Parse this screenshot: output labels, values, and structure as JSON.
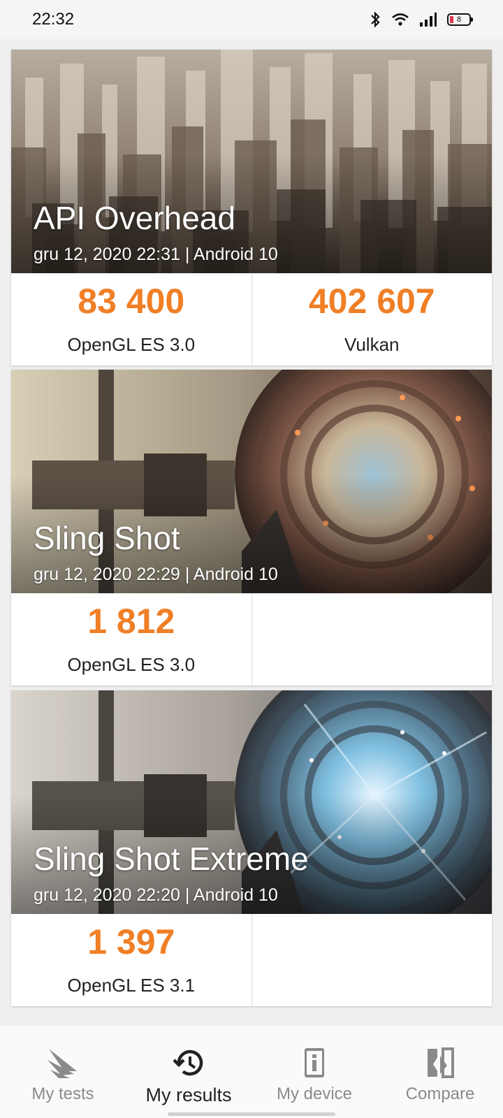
{
  "status_bar": {
    "time": "22:32",
    "battery_level": "8",
    "icons": [
      "bluetooth-icon",
      "wifi-icon",
      "signal-icon",
      "battery-icon"
    ]
  },
  "results": [
    {
      "title": "API Overhead",
      "meta": "gru 12, 2020 22:31 | Android 10",
      "scores": [
        {
          "value": "83 400",
          "label": "OpenGL ES 3.0"
        },
        {
          "value": "402 607",
          "label": "Vulkan"
        }
      ]
    },
    {
      "title": "Sling Shot",
      "meta": "gru 12, 2020 22:29 | Android 10",
      "scores": [
        {
          "value": "1 812",
          "label": "OpenGL ES 3.0"
        }
      ]
    },
    {
      "title": "Sling Shot Extreme",
      "meta": "gru 12, 2020 22:20 | Android 10",
      "scores": [
        {
          "value": "1 397",
          "label": "OpenGL ES 3.1"
        }
      ]
    }
  ],
  "bottom_nav": {
    "items": [
      {
        "label": "My tests",
        "icon": "3dmark-logo-icon",
        "active": false
      },
      {
        "label": "My results",
        "icon": "history-icon",
        "active": true
      },
      {
        "label": "My device",
        "icon": "device-info-icon",
        "active": false
      },
      {
        "label": "Compare",
        "icon": "compare-icon",
        "active": false
      }
    ]
  },
  "colors": {
    "score": "#f07f26",
    "background": "#efefef"
  }
}
